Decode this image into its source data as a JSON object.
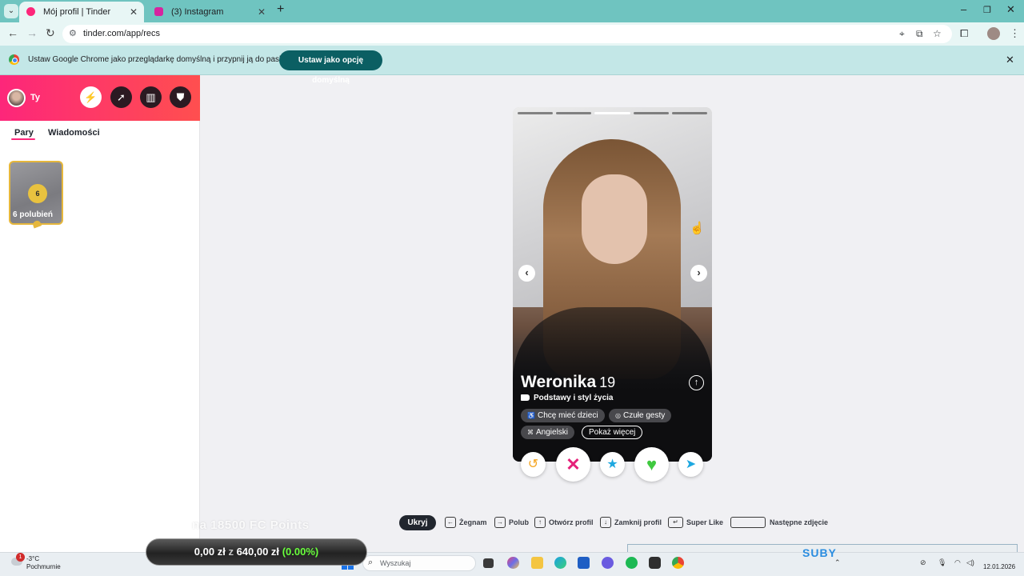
{
  "browser": {
    "tabs": [
      {
        "title": "Mój profil | Tinder",
        "favicon_color": "#fd267a"
      },
      {
        "title": "(3) Instagram",
        "favicon_color": "#d6249f"
      }
    ],
    "url": "tinder.com/app/recs",
    "window_controls": [
      "–",
      "❐",
      "✕"
    ]
  },
  "infobar": {
    "message": "Ustaw Google Chrome jako przeglądarkę domyślną i przypnij ją do paska zadań",
    "button": "Ustaw jako opcję domyślną",
    "close": "✕"
  },
  "sidebar": {
    "user_label": "Ty",
    "tabs": [
      "Pary",
      "Wiadomości"
    ],
    "active_tab": "Pary",
    "likes_count": "6",
    "likes_label": "6 polubień"
  },
  "profile": {
    "name": "Weronika",
    "age": "19",
    "photo_count": 5,
    "active_photo": 3,
    "section_title": "Podstawy i styl życia",
    "chips": [
      {
        "icon": "baby-icon",
        "label": "Chcę mieć dzieci"
      },
      {
        "icon": "gesture-icon",
        "label": "Czułe gesty"
      },
      {
        "icon": "language-icon",
        "label": "Angielski"
      }
    ],
    "show_more": "Pokaż więcej"
  },
  "actions": [
    "rewind-icon",
    "nope-icon",
    "super-like-icon",
    "like-icon",
    "boost-icon"
  ],
  "legend": {
    "hide": "Ukryj",
    "items": [
      {
        "key": "←",
        "label": "Żegnam"
      },
      {
        "key": "→",
        "label": "Polub"
      },
      {
        "key": "↑",
        "label": "Otwórz profil"
      },
      {
        "key": "↓",
        "label": "Zamknij profil"
      },
      {
        "key": "↵",
        "label": "Super Like"
      },
      {
        "key": "",
        "label": "Następne zdjęcie"
      }
    ]
  },
  "overlay": {
    "points_text": "na 18500 FC Points",
    "price_a": "0,00 zł",
    "price_sep": "z",
    "price_b": "640,00 zł",
    "price_pct": "(0.00%)",
    "subs": "SUBY"
  },
  "taskbar": {
    "badge": "1",
    "temperature": "-3°C",
    "condition": "Pochmurnie",
    "search_placeholder": "Wyszukaj",
    "date": "12.01.2026"
  },
  "colors": {
    "tinder_gradient_start": "#fd267a",
    "tinder_gradient_end": "#ff4f4f",
    "chrome_frame": "#6fc4c0",
    "infobar_button": "#0b5f63",
    "likes_gold": "#e9c23f"
  }
}
